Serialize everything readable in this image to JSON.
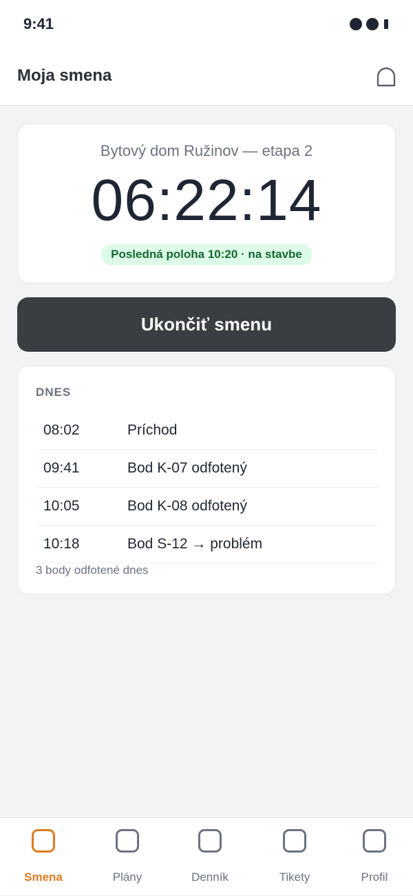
{
  "status": {
    "time": "9:41"
  },
  "header": {
    "title": "Moja smena",
    "notification_icon": "bell-icon"
  },
  "shift": {
    "site": "Bytový dom Ružinov — etapa 2",
    "elapsed": "06:22:14",
    "location_status": "Posledná poloha 10:20 · na stavbe"
  },
  "end_shift": {
    "label": "Ukončiť smenu"
  },
  "today": {
    "heading": "DNES",
    "events": [
      {
        "time": "08:02",
        "label": "Príchod"
      },
      {
        "time": "09:41",
        "label": "Bod K-07 odfotený"
      },
      {
        "time": "10:05",
        "label": "Bod K-08 odfotený"
      },
      {
        "time": "10:18",
        "label": "Bod S-12 → problém"
      }
    ],
    "summary": "3 body odfotené dnes"
  },
  "tabs": [
    {
      "label": "Smena",
      "icon": "shift-icon",
      "active": true
    },
    {
      "label": "Plány",
      "icon": "plans-icon",
      "active": false
    },
    {
      "label": "Denník",
      "icon": "journal-icon",
      "active": false
    },
    {
      "label": "Tikety",
      "icon": "tickets-icon",
      "active": false
    },
    {
      "label": "Profil",
      "icon": "profile-icon",
      "active": false
    }
  ],
  "colors": {
    "accent": "#e07b22",
    "badge_bg": "#dcfce7",
    "badge_text": "#166534",
    "button_bg": "#3a3d42"
  }
}
